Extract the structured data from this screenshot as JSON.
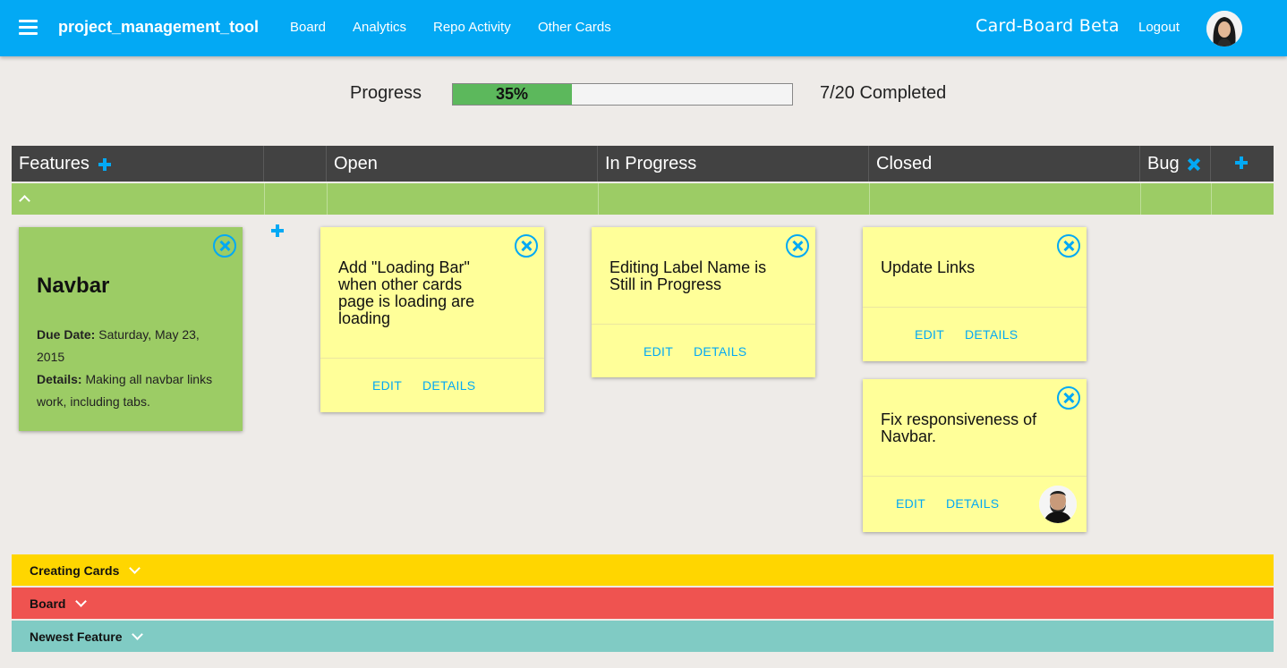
{
  "navbar": {
    "app_name": "project_management_tool",
    "links": [
      "Board",
      "Analytics",
      "Repo Activity",
      "Other Cards"
    ],
    "board_title": "Card-Board Beta",
    "logout_label": "Logout"
  },
  "progress": {
    "label": "Progress",
    "percent": 35,
    "percent_label": "35%",
    "completed_label": "7/20 Completed"
  },
  "columns": {
    "features": "Features",
    "open": "Open",
    "in_progress": "In Progress",
    "closed": "Closed",
    "bug": "Bug"
  },
  "feature_card": {
    "title": "Navbar",
    "due_label": "Due Date:",
    "due_value": "Saturday, May 23, 2015",
    "details_label": "Details:",
    "details_value": "Making all navbar links work, including tabs."
  },
  "cards": [
    {
      "column": "open",
      "title": "Add \"Loading Bar\" when other cards page is loading are loading",
      "edit": "EDIT",
      "details": "DETAILS"
    },
    {
      "column": "in_progress",
      "title": "Editing Label Name is Still in Progress",
      "edit": "EDIT",
      "details": "DETAILS"
    },
    {
      "column": "closed",
      "title": "Update Links",
      "edit": "EDIT",
      "details": "DETAILS"
    },
    {
      "column": "closed",
      "title": "Fix responsiveness of Navbar.",
      "edit": "EDIT",
      "details": "DETAILS"
    }
  ],
  "lanes": [
    {
      "label": "Creating Cards",
      "color": "#ffd600"
    },
    {
      "label": "Board",
      "color": "#ef5350"
    },
    {
      "label": "Newest Feature",
      "color": "#80cbc4"
    }
  ],
  "colors": {
    "navbar": "#03a9f4",
    "header_row": "#424242",
    "feature_lane": "#9ccc65",
    "card": "#ffff99",
    "progress_fill": "#5cb85c"
  }
}
